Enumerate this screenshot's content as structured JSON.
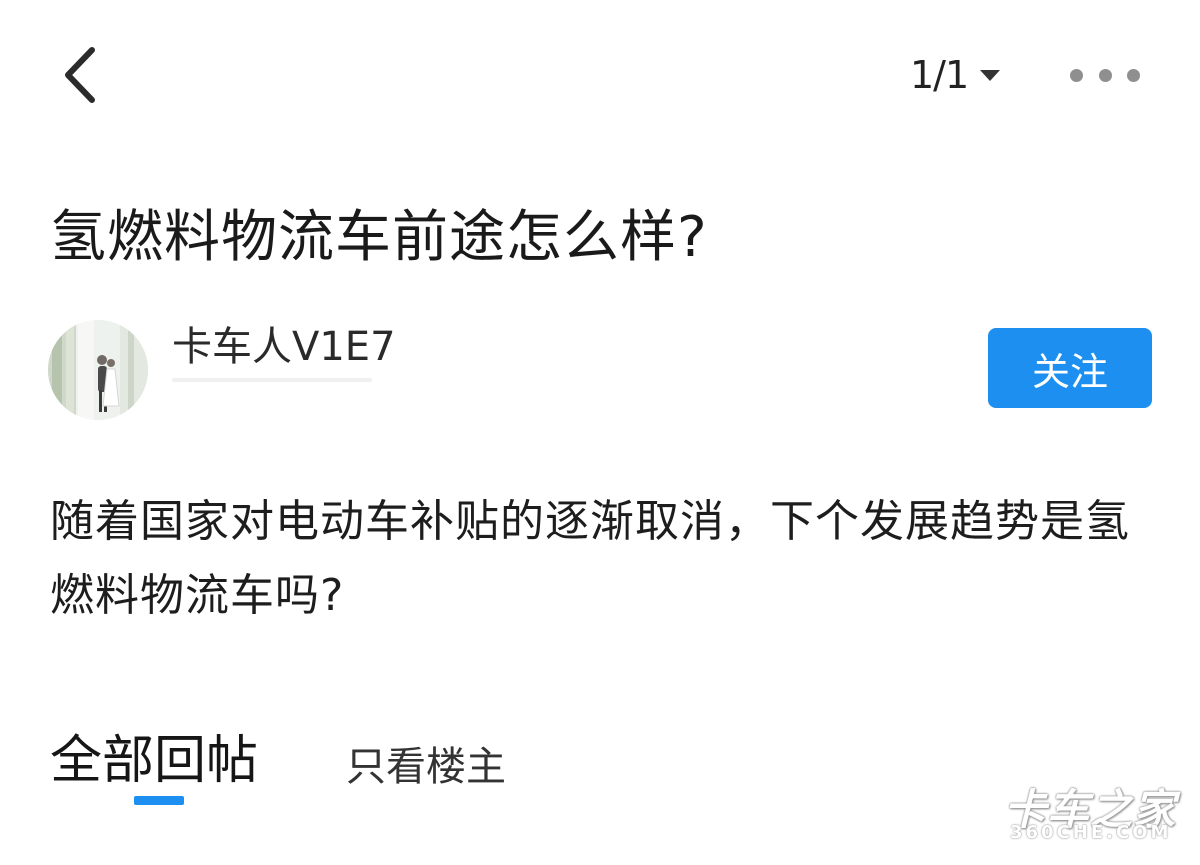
{
  "header": {
    "back_icon": "chevron-left-icon",
    "page_indicator": "1/1",
    "dropdown_icon": "caret-down-icon",
    "more_icon": "more-horizontal-icon"
  },
  "post": {
    "title": "氢燃料物流车前途怎么样?",
    "author": {
      "name": "卡车人V1E7"
    },
    "follow_label": "关注",
    "body": "随着国家对电动车补贴的逐渐取消，下个发展趋势是氢燃料物流车吗?"
  },
  "tabs": {
    "all_replies": "全部回帖",
    "op_only": "只看楼主"
  },
  "watermark": {
    "main": "卡车之家",
    "sub": "360CHE.COM"
  },
  "colors": {
    "accent": "#1c8ff0",
    "text": "#1d1d1d",
    "muted": "#8f8f8f"
  }
}
